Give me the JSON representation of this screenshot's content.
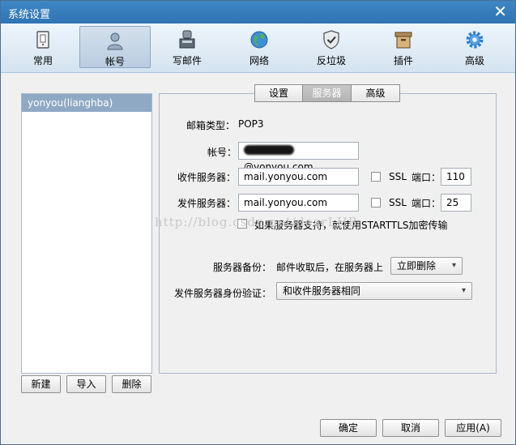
{
  "window": {
    "title": "系统设置",
    "close_label": "✕"
  },
  "toolbar": {
    "items": [
      {
        "label": "常用",
        "icon": "general-icon"
      },
      {
        "label": "帐号",
        "icon": "account-icon",
        "active": true
      },
      {
        "label": "写邮件",
        "icon": "compose-icon"
      },
      {
        "label": "网络",
        "icon": "network-icon"
      },
      {
        "label": "反垃圾",
        "icon": "antispam-shield-icon"
      },
      {
        "label": "插件",
        "icon": "plugin-icon"
      },
      {
        "label": "高级",
        "icon": "gear-icon"
      }
    ]
  },
  "accounts": {
    "items": [
      "yonyou(lianghba)"
    ],
    "buttons": {
      "new": "新建",
      "import": "导入",
      "delete": "删除"
    }
  },
  "tabs": [
    {
      "label": "设置"
    },
    {
      "label": "服务器",
      "active": true
    },
    {
      "label": "高级"
    }
  ],
  "server": {
    "mailbox_type_label": "邮箱类型：",
    "mailbox_type_value": "POP3",
    "account_label": "帐号：",
    "account_value_suffix": "@yonyou.com",
    "incoming_label": "收件服务器：",
    "incoming_value": "mail.yonyou.com",
    "outgoing_label": "发件服务器：",
    "outgoing_value": "mail.yonyou.com",
    "ssl_label": "SSL",
    "port_label": "端口：",
    "incoming_port": "110",
    "outgoing_port": "25",
    "starttls_label": "如果服务器支持，就使用STARTTLS加密传输",
    "backup_label": "服务器备份：",
    "backup_desc": "邮件收取后，在服务器上",
    "backup_option": "立即删除",
    "auth_label": "发件服务器身份验证：",
    "auth_option": "和收件服务器相同"
  },
  "watermark": "http://blog.csdn.net/dearLHB",
  "footer": {
    "ok": "确定",
    "cancel": "取消",
    "apply": "应用(A)"
  },
  "colors": {
    "titlebar": "#2f74b3",
    "selected_account": "#8fa9c5"
  }
}
